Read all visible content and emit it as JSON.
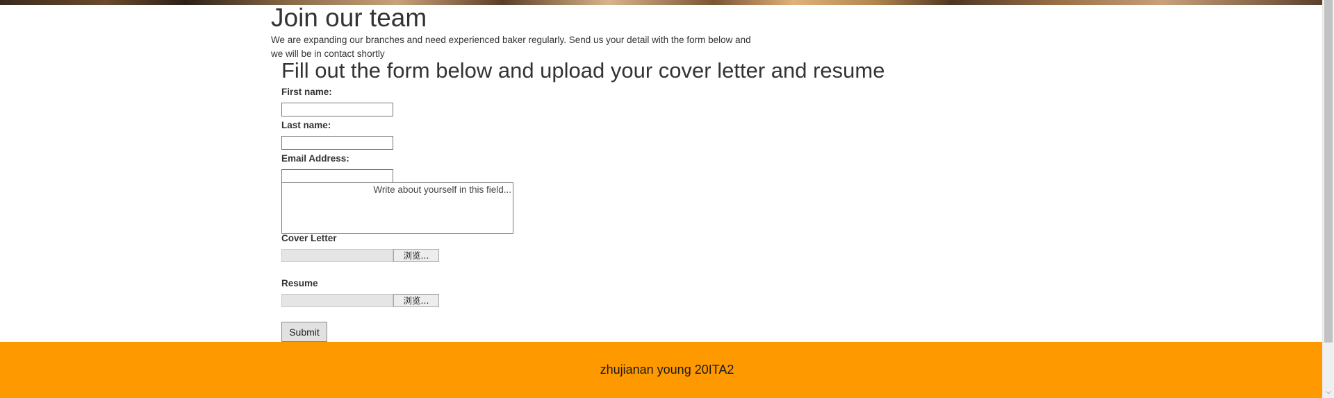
{
  "page": {
    "title": "Join our team",
    "intro": "We are expanding our branches and need experienced baker regularly. Send us your detail with the form below and we will be in contact shortly"
  },
  "form": {
    "heading": "Fill out the form below and upload your cover letter and resume",
    "first_name_label": "First name:",
    "first_name_value": "",
    "last_name_label": "Last name:",
    "last_name_value": "",
    "email_label": "Email Address:",
    "email_value": "",
    "about_placeholder": "Write about yourself in this field...",
    "cover_letter_label": "Cover Letter",
    "resume_label": "Resume",
    "browse_label": "浏览...",
    "submit_label": "Submit"
  },
  "footer": {
    "text": "zhujianan young 20ITA2",
    "background_color": "#ff9900"
  },
  "icons": {
    "scroll_down": "chevron-down-icon"
  }
}
